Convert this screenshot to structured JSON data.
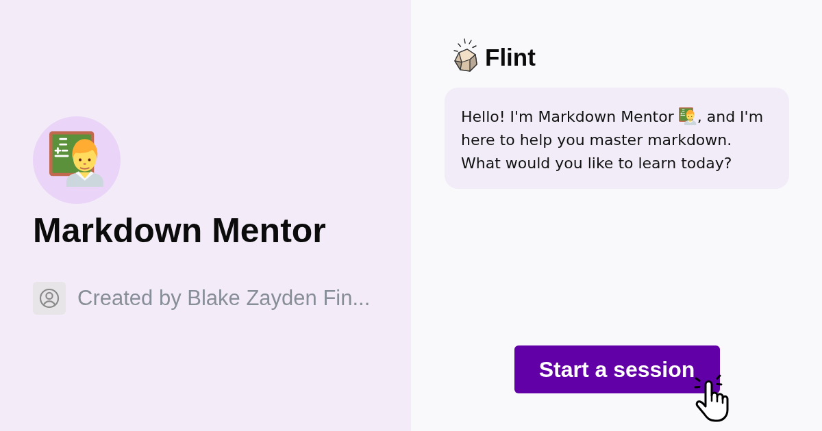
{
  "profile": {
    "name": "Markdown Mentor",
    "creator": "Created by Blake Zayden Fin..."
  },
  "chat": {
    "brand": "Flint",
    "message": {
      "parts": [
        {
          "kind": "text",
          "text": "Hello! I'm Markdown Mentor"
        },
        {
          "kind": "emoji"
        },
        {
          "kind": "text",
          "text": ", and I'm here to help you master markdown. What would you like to learn today?"
        }
      ]
    },
    "action": "Start a session"
  }
}
